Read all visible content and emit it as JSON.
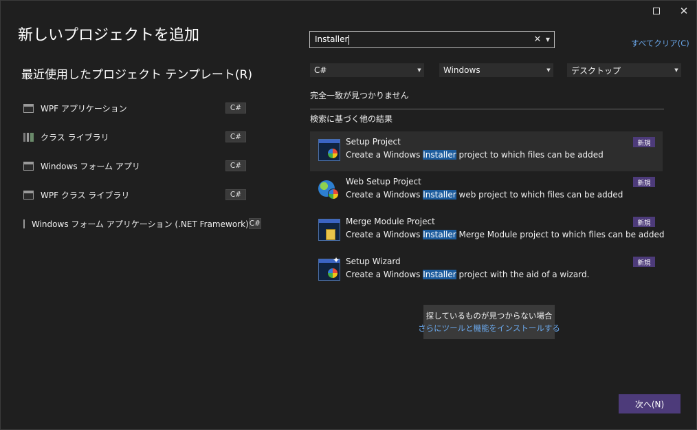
{
  "window": {
    "title": "新しいプロジェクトを追加"
  },
  "recent": {
    "heading": "最近使用したプロジェクト テンプレート(R)",
    "items": [
      {
        "label": "WPF アプリケーション",
        "lang": "C#",
        "icon": "window-app-icon"
      },
      {
        "label": "クラス ライブラリ",
        "lang": "C#",
        "icon": "class-library-icon"
      },
      {
        "label": "Windows フォーム アプリ",
        "lang": "C#",
        "icon": "window-app-icon"
      },
      {
        "label": "WPF クラス ライブラリ",
        "lang": "C#",
        "icon": "window-app-icon"
      },
      {
        "label": "Windows フォーム アプリケーション (.NET Framework)",
        "lang": "C#",
        "icon": "window-app-icon"
      }
    ]
  },
  "search": {
    "value": "Installer",
    "clear_all": "すべてクリア(C)"
  },
  "filters": {
    "language": "C#",
    "platform": "Windows",
    "project_type": "デスクトップ"
  },
  "messages": {
    "no_match": "完全一致が見つかりません",
    "other_results": "検索に基づく他の結果"
  },
  "results": [
    {
      "name": "Setup Project",
      "desc_before": "Create a Windows ",
      "desc_highlight": "Installer",
      "desc_after": " project to which files can be added",
      "badge": "新規",
      "icon": "setup-project-icon"
    },
    {
      "name": "Web Setup Project",
      "desc_before": "Create a Windows ",
      "desc_highlight": "Installer",
      "desc_after": " web project to which files can be added",
      "badge": "新規",
      "icon": "web-setup-project-icon"
    },
    {
      "name": "Merge Module Project",
      "desc_before": "Create a Windows ",
      "desc_highlight": "Installer",
      "desc_after": " Merge Module project to which files can be added",
      "badge": "新規",
      "icon": "merge-module-project-icon"
    },
    {
      "name": "Setup Wizard",
      "desc_before": "Create a Windows ",
      "desc_highlight": "Installer",
      "desc_after": " project with the aid of a wizard.",
      "badge": "新規",
      "icon": "setup-wizard-icon"
    }
  ],
  "help": {
    "line1": "探しているものが見つからない場合",
    "link": "さらにツールと機能をインストールする"
  },
  "footer": {
    "next_label": "次へ(N)"
  },
  "colors": {
    "background": "#1f1f1f",
    "accent": "#4d3b7a",
    "link": "#6aa7ea",
    "highlight": "#1c5c9e"
  }
}
